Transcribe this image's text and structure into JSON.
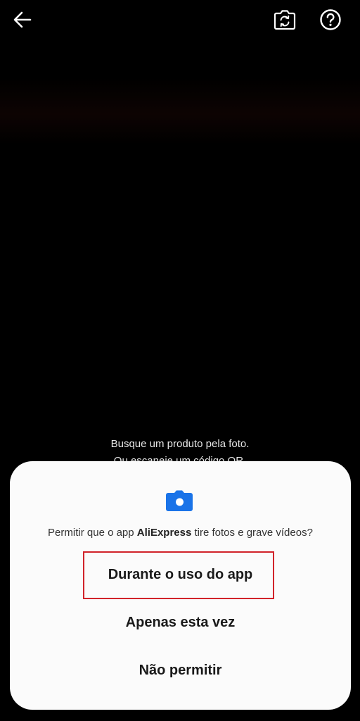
{
  "camera": {
    "hint_line1": "Busque um produto pela foto.",
    "hint_line2": "Ou escaneie um código QR."
  },
  "topbar": {
    "back_icon": "arrow-left-icon",
    "flip_icon": "camera-flip-icon",
    "help_icon": "help-circle-icon"
  },
  "dialog": {
    "icon": "camera-icon",
    "icon_color": "#1a73e8",
    "prompt_prefix": "Permitir que o app ",
    "app_name": "AliExpress",
    "prompt_suffix": " tire fotos e grave vídeos?",
    "options": [
      {
        "label": "Durante o uso do app"
      },
      {
        "label": "Apenas esta vez"
      },
      {
        "label": "Não permitir"
      }
    ],
    "highlight_color": "#d1232a"
  }
}
